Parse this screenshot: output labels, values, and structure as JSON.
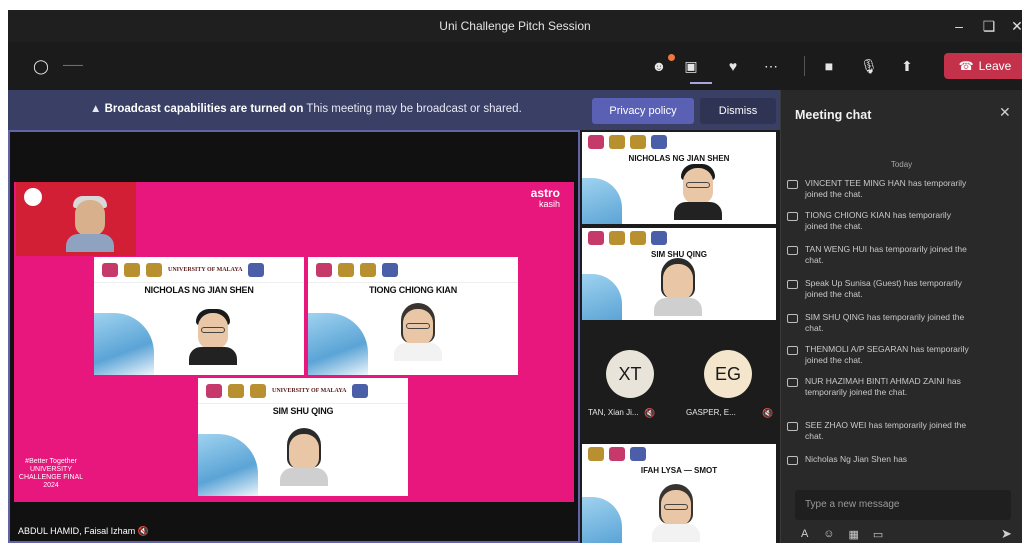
{
  "window": {
    "title": "Uni Challenge Pitch Session"
  },
  "toolbar": {
    "timer": "——",
    "leave_label": "Leave"
  },
  "banner": {
    "bold": "Broadcast capabilities are turned on",
    "text": "This meeting may be broadcast or shared.",
    "privacy_label": "Privacy policy",
    "dismiss_label": "Dismiss"
  },
  "stage": {
    "presenter_name": "ABDUL HAMID, Faisal Izham",
    "logo_line1": "astro",
    "logo_line2": "kasih",
    "caption": "#Better Together UNIVERSITY CHALLENGE FINAL 2024",
    "university_text": "UNIVERSITY OF MALAYA",
    "slides": [
      {
        "name": "NICHOLAS NG JIAN SHEN"
      },
      {
        "name": "TIONG CHIONG KIAN"
      },
      {
        "name": "SIM SHU QING"
      }
    ]
  },
  "right_column": {
    "thumbs": [
      {
        "name": "NICHOLAS NG JIAN SHEN"
      },
      {
        "name": "SIM SHU QING"
      }
    ],
    "avatars": [
      {
        "initials": "XT",
        "label": "TAN, Xian Ji...",
        "color": "#e8e4da"
      },
      {
        "initials": "EG",
        "label": "GASPER, E...",
        "color": "#f3e6cc"
      }
    ],
    "bottom_thumb_name": "IFAH LYSA — SMOT"
  },
  "chat": {
    "title": "Meeting chat",
    "today": "Today",
    "messages": [
      "VINCENT TEE MING HAN has temporarily joined the chat.",
      "TIONG CHIONG KIAN has temporarily joined the chat.",
      "TAN WENG HUI has temporarily joined the chat.",
      "Speak Up Sunisa (Guest) has temporarily joined the chat.",
      "SIM SHU QING has temporarily joined the chat.",
      "THENMOLI A/P SEGARAN has temporarily joined the chat.",
      "NUR HAZIMAH BINTI AHMAD ZAINI has temporarily joined the chat.",
      "SEE ZHAO WEI has temporarily joined the chat.",
      "Nicholas Ng Jian Shen has"
    ],
    "input_placeholder": "Type a new message"
  },
  "colors": {
    "accent": "#6264a7",
    "leave": "#c4314b",
    "banner_bg": "#3a3f66",
    "stage_pink": "#e8177d"
  },
  "icons": [
    "shield-icon",
    "people-icon",
    "chat-icon",
    "reactions-icon",
    "more-icon",
    "camera-icon",
    "mic-icon",
    "share-icon",
    "phone-icon",
    "minimize-icon",
    "maximize-icon",
    "close-icon",
    "warning-icon",
    "format-icon",
    "emoji-icon",
    "gif-icon",
    "sticker-icon",
    "send-icon"
  ]
}
